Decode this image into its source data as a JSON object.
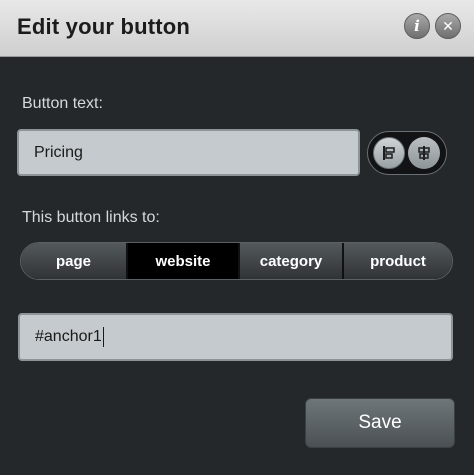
{
  "dialog": {
    "title": "Edit your button",
    "info_icon": "info-icon",
    "close_icon": "close-icon"
  },
  "button_text": {
    "label": "Button text:",
    "value": "Pricing"
  },
  "alignment": {
    "options": [
      "align-left-icon",
      "align-center-icon"
    ],
    "selected": "align-left"
  },
  "links": {
    "label": "This button links to:",
    "tabs": [
      {
        "label": "page"
      },
      {
        "label": "website"
      },
      {
        "label": "category"
      },
      {
        "label": "product"
      }
    ],
    "selected": "website"
  },
  "url": {
    "value": "#anchor1"
  },
  "actions": {
    "save_label": "Save"
  },
  "colors": {
    "background": "#24282b",
    "header": "#d8d8d8",
    "field": "#c4cacd",
    "selected_tab": "#000000"
  }
}
